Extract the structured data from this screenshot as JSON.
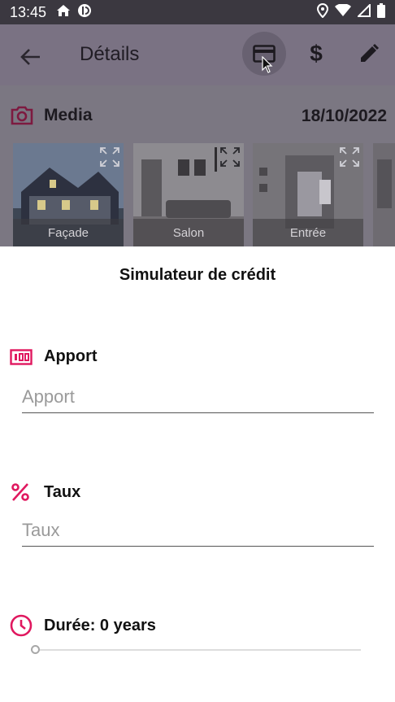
{
  "status_bar": {
    "time": "13:45",
    "left_icons": [
      "home-icon",
      "data-saver-icon"
    ],
    "right_icons": [
      "location-icon",
      "wifi-icon",
      "signal-icon",
      "battery-icon"
    ]
  },
  "app_bar": {
    "title": "Détails",
    "actions": [
      "credit-card-icon",
      "dollar-icon",
      "edit-icon"
    ],
    "dollar_glyph": "$"
  },
  "media": {
    "title": "Media",
    "date": "18/10/2022",
    "thumbnails": [
      {
        "caption": "Façade",
        "icon": "expand-icon"
      },
      {
        "caption": "Salon",
        "icon": "expand-icon"
      },
      {
        "caption": "Entrée",
        "icon": "expand-icon"
      }
    ]
  },
  "simulator": {
    "title": "Simulateur de crédit",
    "apport": {
      "label": "Apport",
      "placeholder": "Apport",
      "value": ""
    },
    "taux": {
      "label": "Taux",
      "placeholder": "Taux",
      "value": ""
    },
    "duree": {
      "label": "Durée: 0 years",
      "value": 0
    }
  },
  "colors": {
    "accent": "#e0185f",
    "overlay": "#7a7283",
    "status_bar": "#3b3840"
  }
}
